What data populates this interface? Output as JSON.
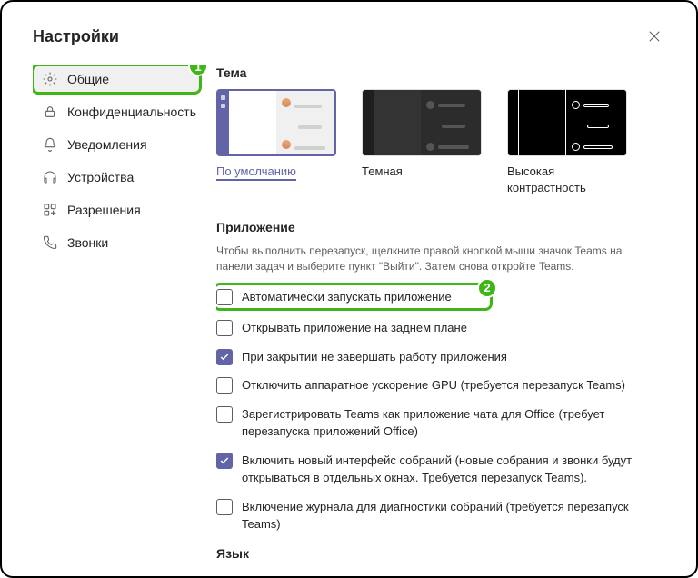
{
  "header": {
    "title": "Настройки"
  },
  "sidebar": {
    "items": [
      {
        "label": "Общие"
      },
      {
        "label": "Конфиденциальность"
      },
      {
        "label": "Уведомления"
      },
      {
        "label": "Устройства"
      },
      {
        "label": "Разрешения"
      },
      {
        "label": "Звонки"
      }
    ]
  },
  "annotations": {
    "badge1": "1",
    "badge2": "2"
  },
  "theme": {
    "title": "Тема",
    "options": [
      {
        "label": "По умолчанию"
      },
      {
        "label": "Темная"
      },
      {
        "label": "Высокая контрастность"
      }
    ]
  },
  "application": {
    "title": "Приложение",
    "description": "Чтобы выполнить перезапуск, щелкните правой кнопкой мыши значок Teams на панели задач и выберите пункт \"Выйти\". Затем снова откройте Teams.",
    "options": [
      {
        "label": "Автоматически запускать приложение",
        "checked": false
      },
      {
        "label": "Открывать приложение на заднем плане",
        "checked": false
      },
      {
        "label": "При закрытии не завершать работу приложения",
        "checked": true
      },
      {
        "label": "Отключить аппаратное ускорение GPU (требуется перезапуск Teams)",
        "checked": false
      },
      {
        "label": "Зарегистрировать Teams как приложение чата для Office (требует перезапуска приложений Office)",
        "checked": false
      },
      {
        "label": "Включить новый интерфейс собраний (новые собрания и звонки будут открываться в отдельных окнах. Требуется перезапуск Teams).",
        "checked": true
      },
      {
        "label": "Включение журнала для диагностики собраний (требуется перезапуск Teams)",
        "checked": false
      }
    ]
  },
  "language": {
    "title": "Язык"
  }
}
